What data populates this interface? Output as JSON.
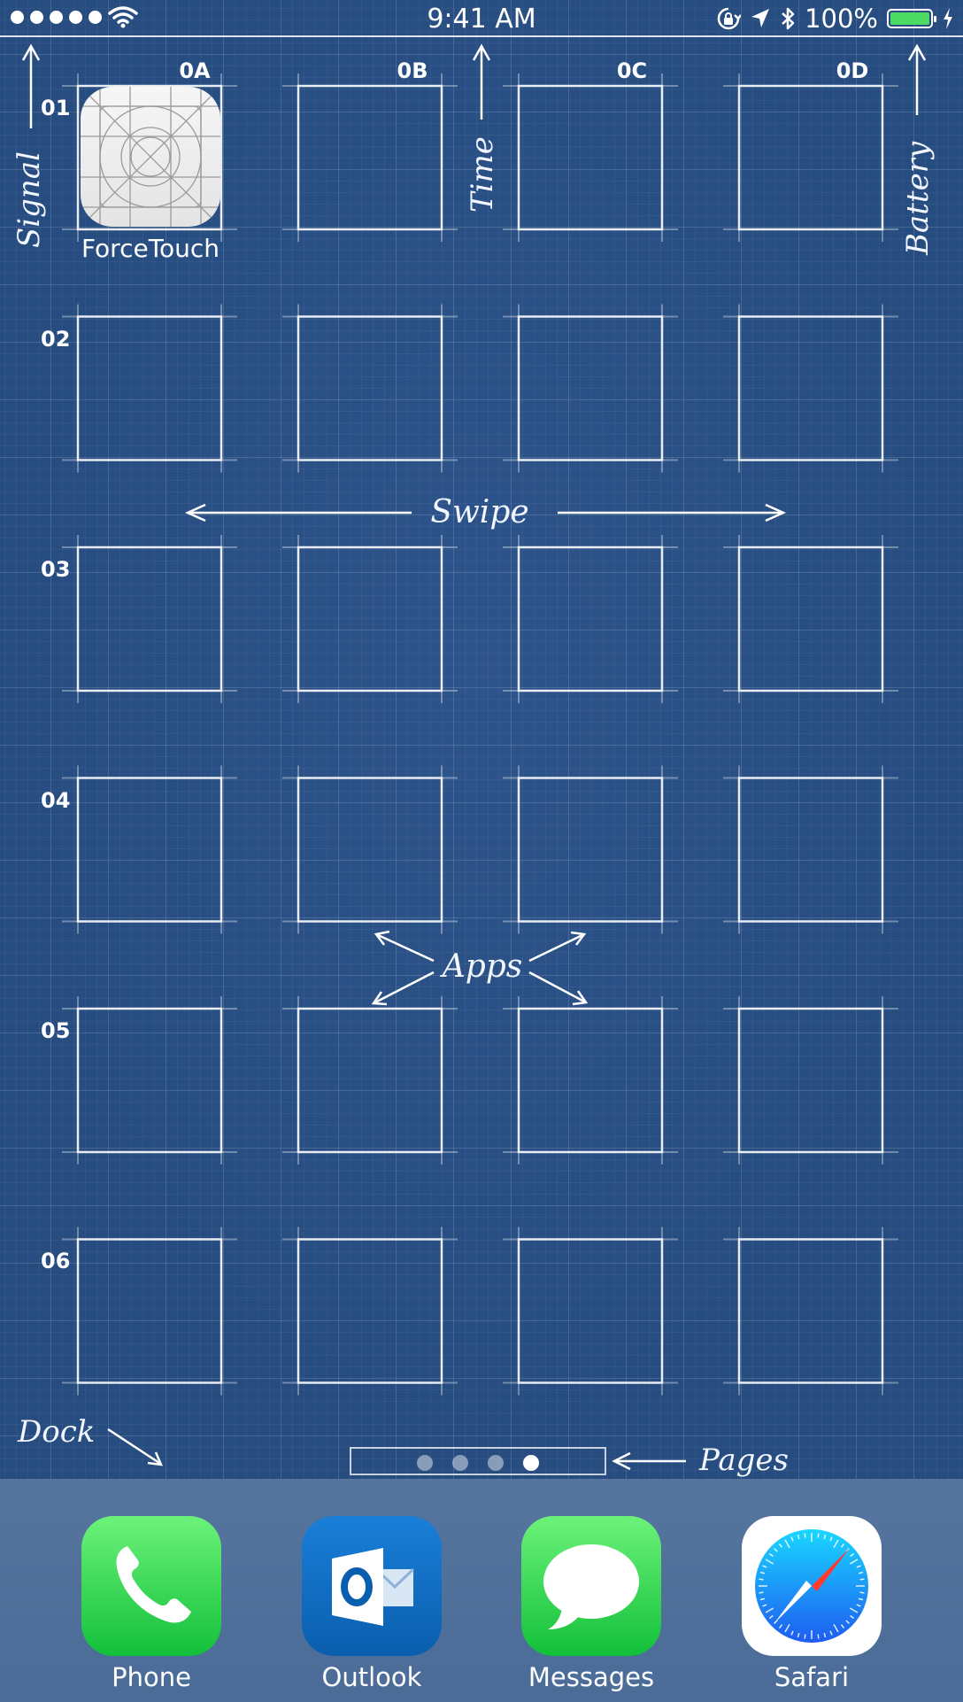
{
  "status_bar": {
    "time": "9:41 AM",
    "battery_percent": "100%",
    "signal_bars": 5,
    "icons": [
      "wifi-icon",
      "rotation-lock-icon",
      "location-icon",
      "bluetooth-icon",
      "battery-icon",
      "charging-icon"
    ]
  },
  "blueprint": {
    "columns": [
      "0A",
      "0B",
      "0C",
      "0D"
    ],
    "rows": [
      "01",
      "02",
      "03",
      "04",
      "05",
      "06"
    ],
    "annotations": {
      "signal": "Signal",
      "time": "Time",
      "battery": "Battery",
      "swipe": "Swipe",
      "apps": "Apps",
      "dock": "Dock",
      "pages": "Pages"
    }
  },
  "home_apps": [
    {
      "label": "ForceTouch",
      "icon": "blank-app-template-icon"
    }
  ],
  "page_indicator": {
    "total": 4,
    "current": 4
  },
  "dock": {
    "apps": [
      {
        "label": "Phone",
        "icon": "phone-icon",
        "color": "#4cd964"
      },
      {
        "label": "Outlook",
        "icon": "outlook-icon",
        "color": "#0f6cc4"
      },
      {
        "label": "Messages",
        "icon": "messages-icon",
        "color": "#4cd964"
      },
      {
        "label": "Safari",
        "icon": "safari-icon",
        "color": "#1e88ff"
      }
    ]
  },
  "colors": {
    "wallpaper": "#264c80",
    "dock": "#4b6c98",
    "battery_fill": "#4cd964"
  }
}
